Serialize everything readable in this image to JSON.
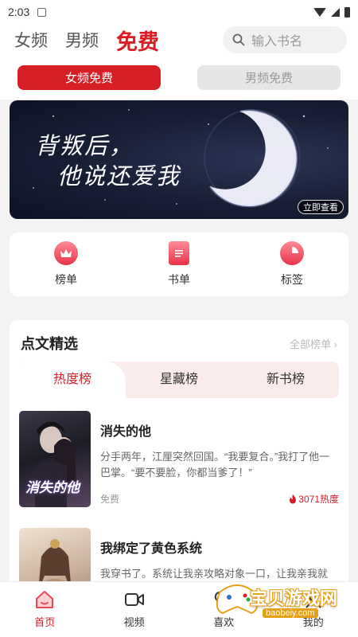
{
  "status": {
    "time": "2:03"
  },
  "top_nav": {
    "tabs": [
      "女频",
      "男频",
      "免费"
    ],
    "active_tab": "免费",
    "search_placeholder": "输入书名"
  },
  "segment": {
    "items": [
      "女频免费",
      "男频免费"
    ],
    "active": "女频免费"
  },
  "banner": {
    "title_line1": "背叛后，",
    "title_line2": "他说还爱我",
    "button": "立即查看"
  },
  "shortcuts": [
    {
      "label": "榜单",
      "icon": "crown-icon"
    },
    {
      "label": "书单",
      "icon": "document-icon"
    },
    {
      "label": "标签",
      "icon": "pie-tag-icon"
    }
  ],
  "section": {
    "title": "点文精选",
    "more": "全部榜单",
    "rank_tabs": [
      "热度榜",
      "星藏榜",
      "新书榜"
    ],
    "active_rank_tab": "热度榜"
  },
  "books": [
    {
      "title": "消失的他",
      "description": "分手两年，江厘突然回国。“我要复合。”我打了他一巴掌。“要不要脸，你都当爹了！”",
      "tag": "免费",
      "heat": "3071热度",
      "cover_text": "消失的他"
    },
    {
      "title": "我绑定了黄色系统",
      "description": "我穿书了。系统让我亲攻略对象一口，让我亲我就亲？偷不。可谁能告诉我为什么不… 任务，会…",
      "tag": "",
      "heat": "",
      "cover_text": ""
    }
  ],
  "bottom_nav": {
    "items": [
      "首页",
      "视频",
      "喜欢",
      "我的"
    ],
    "active": "首页"
  },
  "watermark": {
    "text": "宝贝游戏网",
    "sub": "baobeiy.com"
  },
  "colors": {
    "accent": "#d81e25",
    "banner_bg": "#171d33"
  }
}
